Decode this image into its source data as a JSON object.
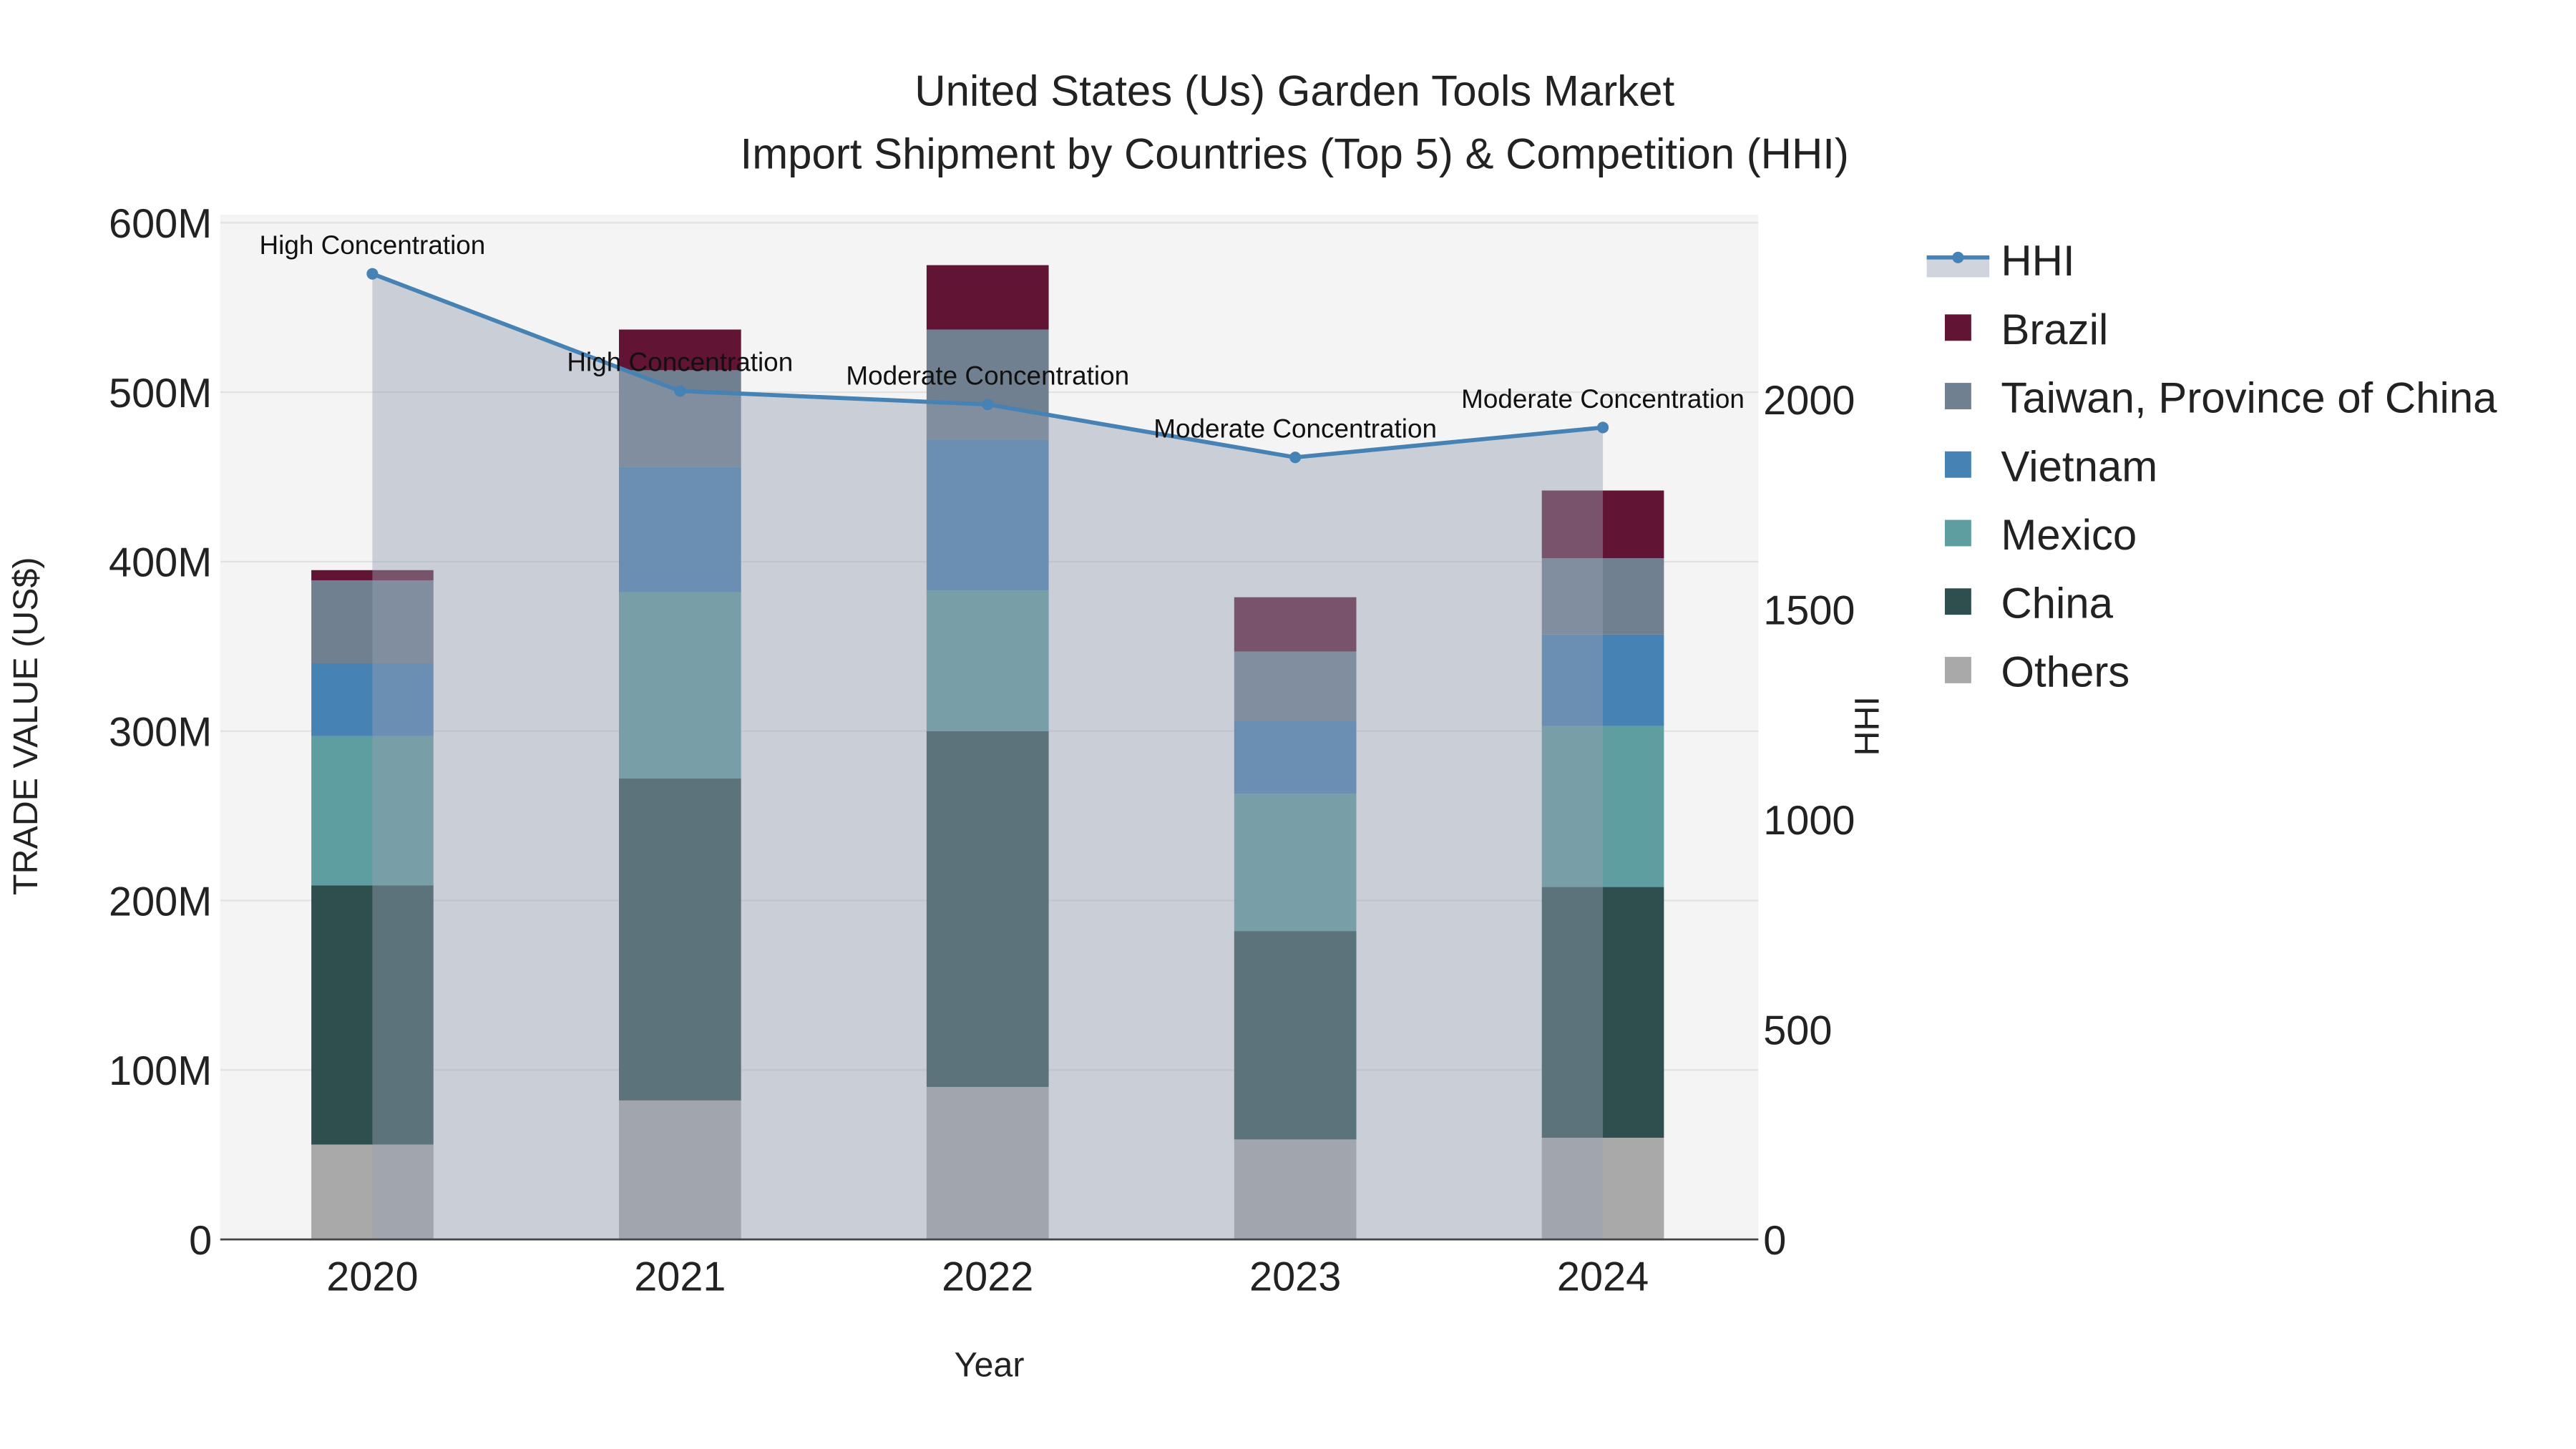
{
  "chart_data": {
    "type": "bar",
    "title_line1": "United States (Us) Garden Tools Market",
    "title_line2": "Import Shipment by Countries (Top 5) & Competition (HHI)",
    "xlabel": "Year",
    "ylabel": "TRADE VALUE (US$)",
    "y2label": "HHI",
    "categories": [
      "2020",
      "2021",
      "2022",
      "2023",
      "2024"
    ],
    "ylim": [
      0,
      600000000
    ],
    "y_ticks": [
      {
        "v": 0,
        "label": "0"
      },
      {
        "v": 100000000,
        "label": "100M"
      },
      {
        "v": 200000000,
        "label": "200M"
      },
      {
        "v": 300000000,
        "label": "300M"
      },
      {
        "v": 400000000,
        "label": "400M"
      },
      {
        "v": 500000000,
        "label": "500M"
      },
      {
        "v": 600000000,
        "label": "600M"
      }
    ],
    "y2lim": [
      0,
      2360
    ],
    "y2_ticks": [
      {
        "v": 0,
        "label": "0"
      },
      {
        "v": 500,
        "label": "500"
      },
      {
        "v": 1000,
        "label": "1000"
      },
      {
        "v": 1500,
        "label": "1500"
      },
      {
        "v": 2000,
        "label": "2000"
      }
    ],
    "series": [
      {
        "name": "Others",
        "color": "#A9A9A9",
        "values": [
          56000000,
          82000000,
          90000000,
          59000000,
          60000000
        ]
      },
      {
        "name": "China",
        "color": "#2F4F4F",
        "values": [
          153000000,
          190000000,
          210000000,
          123000000,
          148000000
        ]
      },
      {
        "name": "Mexico",
        "color": "#5F9EA0",
        "values": [
          88000000,
          110000000,
          83000000,
          81000000,
          95000000
        ]
      },
      {
        "name": "Vietnam",
        "color": "#4682B4",
        "values": [
          43000000,
          74000000,
          89000000,
          43000000,
          54000000
        ]
      },
      {
        "name": "Taiwan, Province of China",
        "color": "#708090",
        "values": [
          49000000,
          57000000,
          65000000,
          41000000,
          45000000
        ]
      },
      {
        "name": "Brazil",
        "color": "#611434",
        "values": [
          6000000,
          24000000,
          38000000,
          32000000,
          40000000
        ]
      }
    ],
    "hhi": {
      "name": "HHI",
      "color": "#4682B4",
      "values": [
        2299,
        2020,
        1988,
        1862,
        1933
      ],
      "annotations": [
        "High Concentration",
        "High Concentration",
        "Moderate Concentration",
        "Moderate Concentration",
        "Moderate Concentration"
      ]
    },
    "legend_order": [
      "HHI",
      "Brazil",
      "Taiwan, Province of China",
      "Vietnam",
      "Mexico",
      "China",
      "Others"
    ],
    "legend_placement": "right"
  }
}
